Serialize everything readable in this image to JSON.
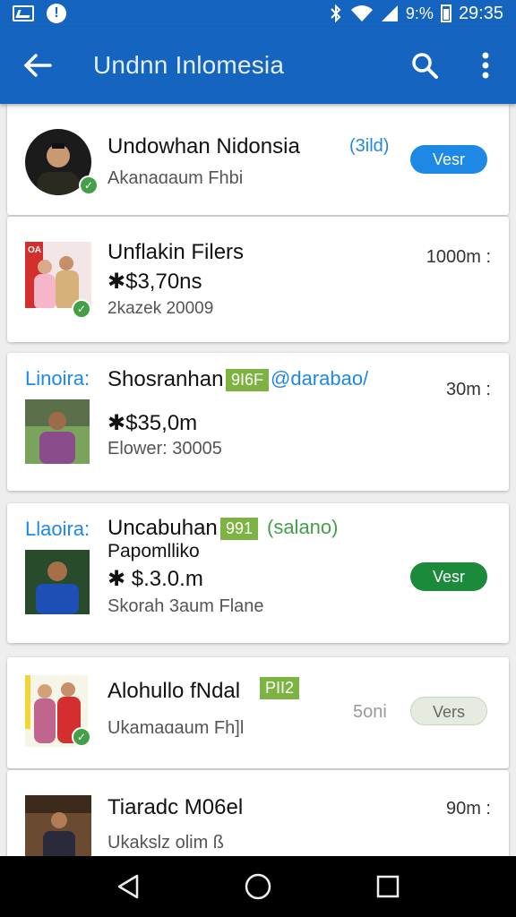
{
  "status_bar": {
    "battery_text": "9:%",
    "time": "29:35"
  },
  "app_bar": {
    "title": "Undnn Inlomesia"
  },
  "items": [
    {
      "name": "Undowhan Nidonsia",
      "sub": "Akanaɑaum Fhbi",
      "tag": "(3ild)",
      "button": "Vesr"
    },
    {
      "name": "Unflakin Filers",
      "price": "✱$3,70ns",
      "sub": "2kazek 20009",
      "thumb_label": "OA",
      "time": "1000m :"
    },
    {
      "label": "Linoira:",
      "name": "Shosranhan",
      "badge": "9I6F",
      "tag": "@darabao/",
      "price": "✱$35,0m",
      "sub": "Elower: 30005",
      "time": "30m :"
    },
    {
      "label": "Llaoira:",
      "name": "Uncabuhan",
      "badge": "991",
      "tag": "(salano)",
      "name2": "Papomlliko",
      "price": "✱ $.3.0.m",
      "sub": "Skorah 3aum Flane",
      "button": "Vesr"
    },
    {
      "name": "Alohullo fNdal",
      "badge": "PII2",
      "time": "5oni",
      "sub": "Ukamaɑaum Fh]l",
      "button": "Vers"
    },
    {
      "name": "Tiaradc M06el",
      "time": "90m :",
      "sub": "Ukakslz olim ß"
    }
  ],
  "colors": {
    "primary": "#1565c0",
    "accent_blue": "#1e88e5",
    "green": "#43a047",
    "badge_green": "#7cb342",
    "pill_blue": "#1e88e5",
    "pill_green": "#1b8a3a",
    "pill_disabled": "#e5ebdf"
  },
  "icons": [
    "image-icon",
    "alert-icon",
    "bluetooth-icon",
    "wifi-icon",
    "signal-icon",
    "battery-icon",
    "back-arrow-icon",
    "search-icon",
    "more-vert-icon",
    "verified-check-icon",
    "nav-back-icon",
    "nav-home-icon",
    "nav-recents-icon"
  ]
}
